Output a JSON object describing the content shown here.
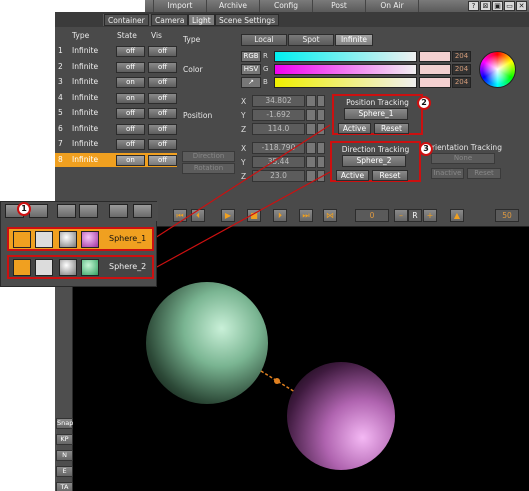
{
  "menubar": {
    "items": [
      "Import",
      "Archive",
      "Config",
      "Post",
      "On Air"
    ],
    "window_buttons": [
      "?",
      "⊠",
      "▣",
      "▭",
      "✕"
    ]
  },
  "tabs": [
    "Container",
    "Camera",
    "Light",
    "Scene Settings"
  ],
  "active_tab": "Light",
  "lights": {
    "headers": {
      "type": "Type",
      "state": "State",
      "vis": "Vis"
    },
    "rows": [
      {
        "idx": "1",
        "type": "Infinite",
        "state": "off",
        "vis": "off"
      },
      {
        "idx": "2",
        "type": "Infinite",
        "state": "off",
        "vis": "off"
      },
      {
        "idx": "3",
        "type": "Infinite",
        "state": "on",
        "vis": "off"
      },
      {
        "idx": "4",
        "type": "Infinite",
        "state": "on",
        "vis": "off"
      },
      {
        "idx": "5",
        "type": "Infinite",
        "state": "off",
        "vis": "off"
      },
      {
        "idx": "6",
        "type": "Infinite",
        "state": "off",
        "vis": "off"
      },
      {
        "idx": "7",
        "type": "Infinite",
        "state": "off",
        "vis": "off"
      },
      {
        "idx": "8",
        "type": "Infinite",
        "state": "on",
        "vis": "off"
      }
    ],
    "selected": 7
  },
  "type_field": {
    "label": "Type",
    "options": [
      "Local",
      "Spot",
      "Infinite"
    ],
    "selected": "Infinite"
  },
  "color": {
    "label": "Color",
    "modes": [
      "RGB",
      "HSV",
      "↗"
    ],
    "channels": [
      {
        "key": "R",
        "value": "204"
      },
      {
        "key": "G",
        "value": "204"
      },
      {
        "key": "B",
        "value": "204"
      }
    ]
  },
  "position": {
    "label": "Position",
    "x": "34.802",
    "y": "-1.692",
    "z": "114.0"
  },
  "direction": {
    "button1": "Direction",
    "button2": "Rotation",
    "x": "-118.790",
    "y": "35.44",
    "z": "23.0"
  },
  "position_tracking": {
    "title": "Position Tracking",
    "target": "Sphere_1",
    "active": "Active",
    "reset": "Reset",
    "callout": "2"
  },
  "direction_tracking": {
    "title": "Direction Tracking",
    "target": "Sphere_2",
    "active": "Active",
    "reset": "Reset",
    "callout": "3"
  },
  "orientation_tracking": {
    "title": "Orientation Tracking",
    "target": "None",
    "active": "Inactive",
    "reset": "Reset"
  },
  "tree": {
    "callout": "1",
    "rows": [
      {
        "label": "Sphere_1",
        "selected": true
      },
      {
        "label": "Sphere_2",
        "selected": false
      }
    ]
  },
  "playbar": {
    "frame": "0",
    "end": "50",
    "r_label": "R"
  },
  "sidebar": {
    "buttons": [
      "Snap",
      "KP",
      "N",
      "E",
      "TA"
    ]
  },
  "colors": {
    "accent": "#f0a020",
    "highlight_border": "#cc1010",
    "panel": "#4a4a4a"
  }
}
